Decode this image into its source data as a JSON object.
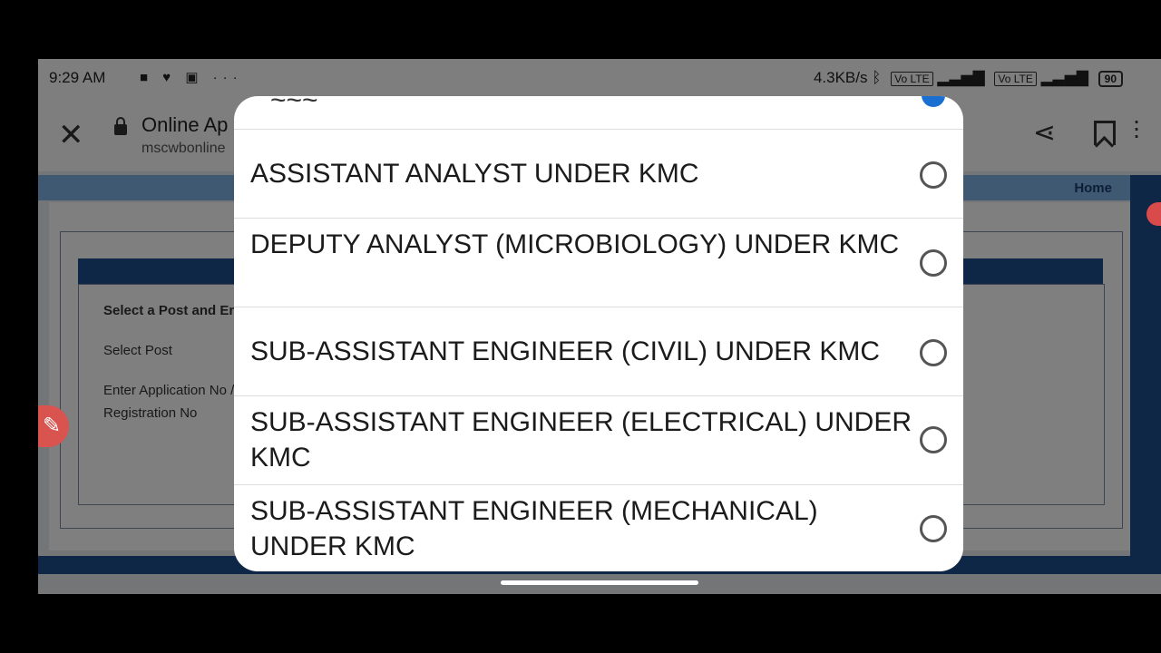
{
  "status": {
    "time": "9:29 AM",
    "icons": [
      "video-icon",
      "heart-icon",
      "vpn-icon",
      "more-icon"
    ],
    "more": "···",
    "net_speed": "4.3KB/s",
    "network_glyphs": [
      "bluetooth-icon",
      "volte-icon",
      "signal-icon",
      "volte-icon",
      "signal-icon"
    ],
    "volte_label": "Vo LTE",
    "battery": "90"
  },
  "browser": {
    "close": "✕",
    "title": "Online Ap",
    "url": "mscwbonline",
    "share_icon": "share-icon",
    "bookmark_icon": "bookmark-icon",
    "menu_icon": "more-vert-icon"
  },
  "page": {
    "home": "Home",
    "section_title": "Select a Post and Ent",
    "select_post": "Select Post",
    "app_no_line1": "Enter Application No /",
    "app_no_line2": "Registration No"
  },
  "dialog": {
    "options": [
      {
        "label": "ASSISTANT ANALYST UNDER KMC",
        "selected": false
      },
      {
        "label": "DEPUTY ANALYST (MICROBIOLOGY) UNDER KMC",
        "selected": false
      },
      {
        "label": "SUB-ASSISTANT ENGINEER (CIVIL) UNDER KMC",
        "selected": false
      },
      {
        "label": "SUB-ASSISTANT ENGINEER (ELECTRICAL) UNDER KMC",
        "selected": false
      },
      {
        "label": "SUB-ASSISTANT ENGINEER (MECHANICAL) UNDER KMC",
        "selected": false
      }
    ]
  },
  "colors": {
    "accent": "#1a6fd1",
    "header_blue": "#1f4e8c"
  }
}
